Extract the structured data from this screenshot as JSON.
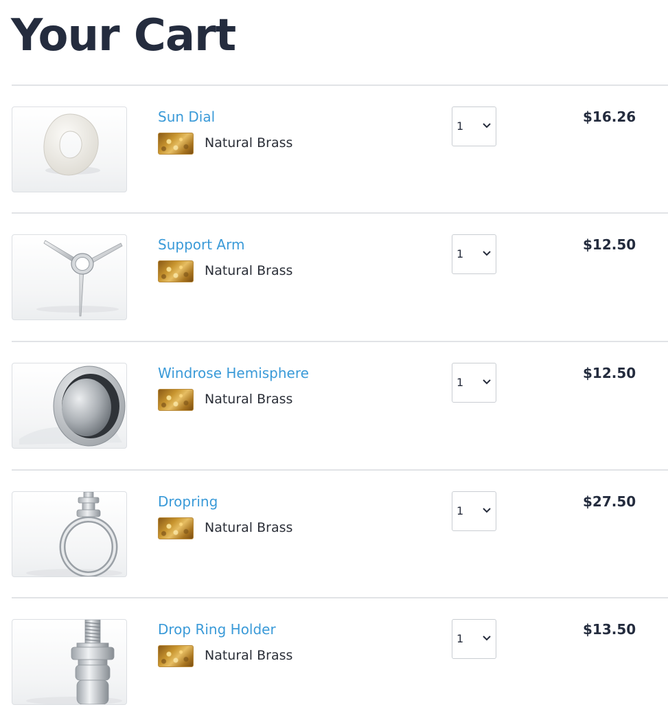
{
  "page": {
    "title": "Your Cart"
  },
  "colors": {
    "title": "#242c3e",
    "link": "#3a9ad8",
    "divider": "#e1e3e6",
    "brass": "#c8952f"
  },
  "cart": {
    "items": [
      {
        "name": "Sun Dial",
        "material": "Natural Brass",
        "quantity": "1",
        "price": "$16.26",
        "image_icon": "washer-ring-icon"
      },
      {
        "name": "Support Arm",
        "material": "Natural Brass",
        "quantity": "1",
        "price": "$12.50",
        "image_icon": "three-arm-bracket-icon"
      },
      {
        "name": "Windrose Hemisphere",
        "material": "Natural Brass",
        "quantity": "1",
        "price": "$12.50",
        "image_icon": "hemisphere-icon"
      },
      {
        "name": "Dropring",
        "material": "Natural Brass",
        "quantity": "1",
        "price": "$27.50",
        "image_icon": "drop-ring-icon"
      },
      {
        "name": "Drop Ring Holder",
        "material": "Natural Brass",
        "quantity": "1",
        "price": "$13.50",
        "image_icon": "threaded-post-icon"
      }
    ]
  }
}
